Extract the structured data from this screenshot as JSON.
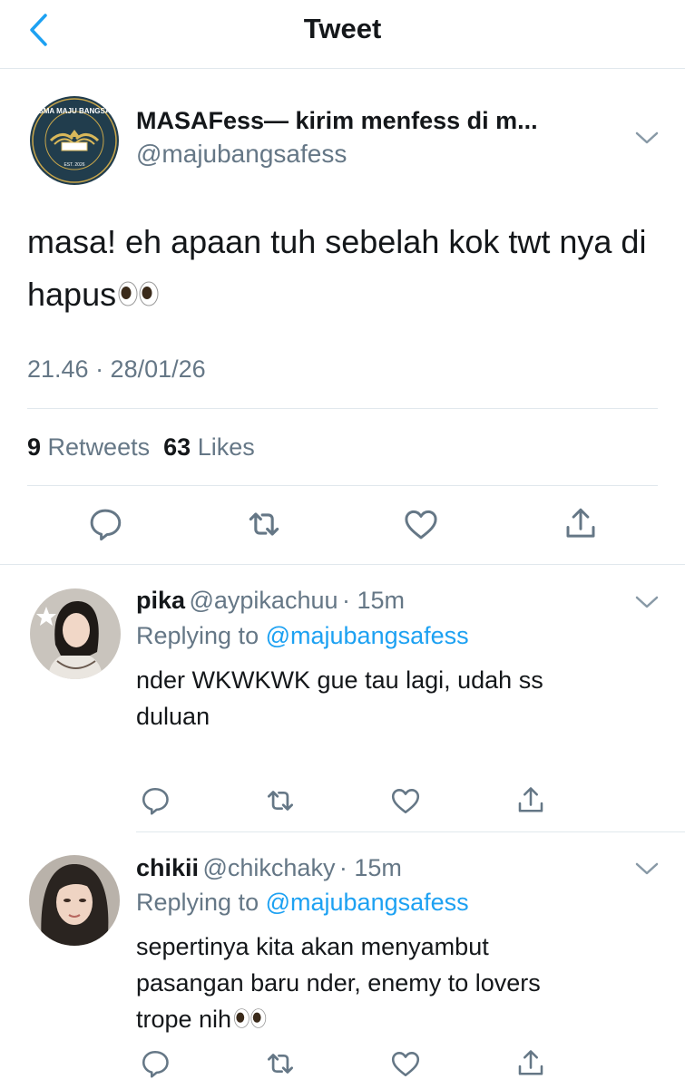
{
  "header": {
    "title": "Tweet"
  },
  "tweet": {
    "author_name": "MASAFess— kirim menfess di m...",
    "author_handle": "@majubangsafess",
    "avatar_label": "SMA MAJU BANGSA",
    "text": "masa! eh apaan tuh sebelah kok twt nya di hapus",
    "time": "21.46 · 28/01/26",
    "retweets_count": "9",
    "retweets_label": "Retweets",
    "likes_count": "63",
    "likes_label": "Likes"
  },
  "replies": [
    {
      "name": "pika",
      "handle": "@aypikachuu",
      "time": "· 15m",
      "replying_label": "Replying to",
      "replying_handle": "@majubangsafess",
      "line1": "nder WKWKWK gue tau lagi, udah ss",
      "line2": "duluan",
      "line3": ""
    },
    {
      "name": "chikii",
      "handle": "@chikchaky",
      "time": "· 15m",
      "replying_label": "Replying to",
      "replying_handle": "@majubangsafess",
      "line1": "sepertinya kita akan menyambut",
      "line2": "pasangan baru nder, enemy to lovers",
      "line3": "trope nih"
    }
  ],
  "colors": {
    "accent": "#1da1f2",
    "text": "#14171a",
    "secondary": "#657786",
    "divider": "#e1e8ed"
  }
}
